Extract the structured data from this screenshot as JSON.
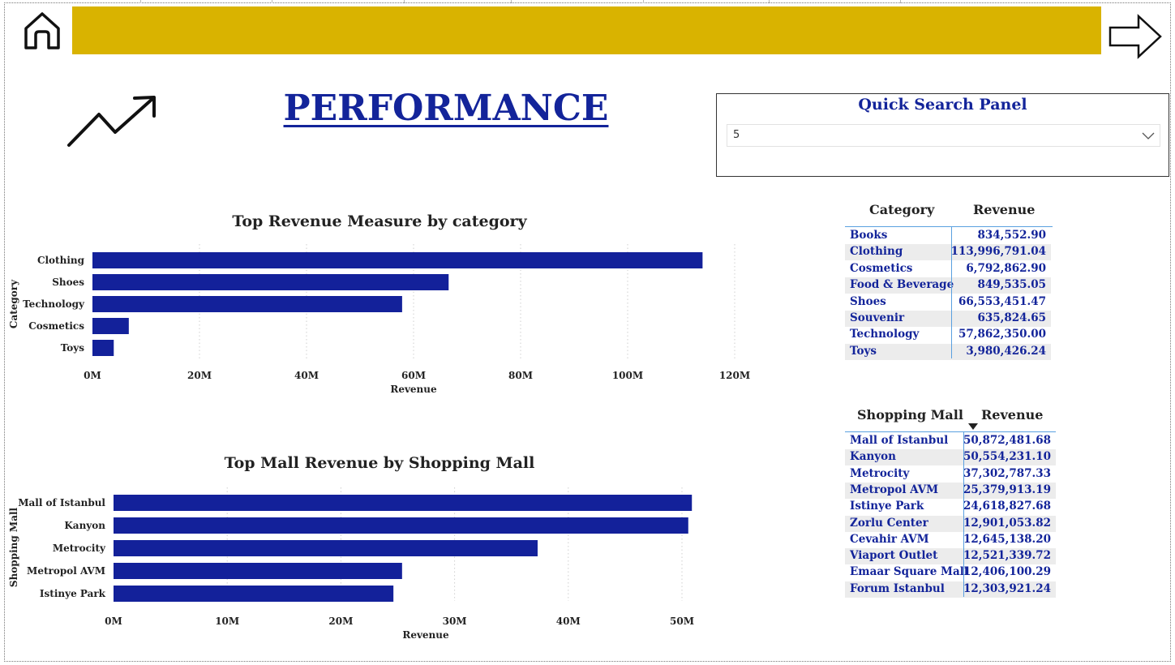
{
  "page": {
    "title": "PERFORMANCE",
    "colors": {
      "banner": "#d9b300",
      "accent": "#13249a",
      "bar": "#13219a",
      "table_line": "#5aa0e0",
      "alt_row": "#ececec"
    },
    "icons": {
      "home": "home-icon",
      "next": "arrow-right-icon",
      "trend": "trend-up-icon"
    }
  },
  "search_panel": {
    "title": "Quick Search Panel",
    "selected": "5",
    "icon": "chevron-down-icon"
  },
  "chart_data": [
    {
      "type": "bar",
      "orientation": "horizontal",
      "title": "Top Revenue Measure by category",
      "xlabel": "Revenue",
      "ylabel": "Category",
      "categories": [
        "Clothing",
        "Shoes",
        "Technology",
        "Cosmetics",
        "Toys"
      ],
      "values": [
        113996791.04,
        66553451.47,
        57862350.0,
        6792862.9,
        3980426.24
      ],
      "xlim": [
        0,
        120000000
      ],
      "ticks": [
        0,
        20000000,
        40000000,
        60000000,
        80000000,
        100000000,
        120000000
      ],
      "tick_labels": [
        "0M",
        "20M",
        "40M",
        "60M",
        "80M",
        "100M",
        "120M"
      ],
      "grid": true
    },
    {
      "type": "bar",
      "orientation": "horizontal",
      "title": "Top Mall Revenue by Shopping Mall",
      "xlabel": "Revenue",
      "ylabel": "Shopping Mall",
      "categories": [
        "Mall of Istanbul",
        "Kanyon",
        "Metrocity",
        "Metropol AVM",
        "Istinye Park"
      ],
      "values": [
        50872481.68,
        50554231.1,
        37302787.33,
        25379913.19,
        24618827.68
      ],
      "xlim": [
        0,
        50000000
      ],
      "ticks": [
        0,
        10000000,
        20000000,
        30000000,
        40000000,
        50000000
      ],
      "tick_labels": [
        "0M",
        "10M",
        "20M",
        "30M",
        "40M",
        "50M"
      ],
      "grid": true
    }
  ],
  "category_table": {
    "headers": [
      "Category",
      "Revenue"
    ],
    "rows": [
      [
        "Books",
        "834,552.90"
      ],
      [
        "Clothing",
        "113,996,791.04"
      ],
      [
        "Cosmetics",
        "6,792,862.90"
      ],
      [
        "Food & Beverage",
        "849,535.05"
      ],
      [
        "Shoes",
        "66,553,451.47"
      ],
      [
        "Souvenir",
        "635,824.65"
      ],
      [
        "Technology",
        "57,862,350.00"
      ],
      [
        "Toys",
        "3,980,426.24"
      ]
    ]
  },
  "mall_table": {
    "headers": [
      "Shopping Mall",
      "Revenue"
    ],
    "sort": "Revenue descending",
    "rows": [
      [
        "Mall of Istanbul",
        "50,872,481.68"
      ],
      [
        "Kanyon",
        "50,554,231.10"
      ],
      [
        "Metrocity",
        "37,302,787.33"
      ],
      [
        "Metropol AVM",
        "25,379,913.19"
      ],
      [
        "Istinye Park",
        "24,618,827.68"
      ],
      [
        "Zorlu Center",
        "12,901,053.82"
      ],
      [
        "Cevahir AVM",
        "12,645,138.20"
      ],
      [
        "Viaport Outlet",
        "12,521,339.72"
      ],
      [
        "Emaar Square Mall",
        "12,406,100.29"
      ],
      [
        "Forum Istanbul",
        "12,303,921.24"
      ]
    ]
  }
}
